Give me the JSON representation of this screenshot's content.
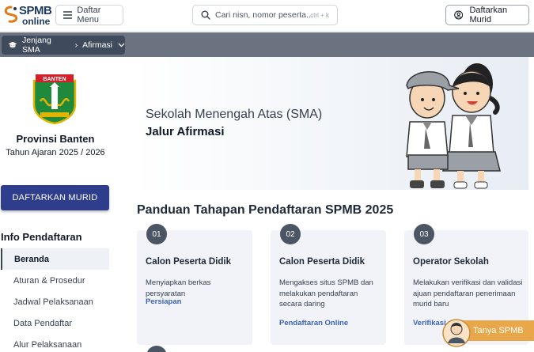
{
  "header": {
    "logo_line1": "SPMB",
    "logo_line2": "online",
    "menu_label": "Daftar Menu",
    "search_placeholder": "Cari nisn, nomor peserta...",
    "search_shortcut": "ctrl + k",
    "register_label": "Daftarkan Murid"
  },
  "breadcrumb": {
    "items": [
      "Jenjang SMA",
      "Afirmasi"
    ]
  },
  "sidebar": {
    "emblem_text": "BANTEN",
    "province": "Provinsi Banten",
    "academic_year": "Tahun Ajaran 2025 / 2026",
    "register_button": "DAFTARKAN MURID",
    "info_title": "Info Pendaftaran",
    "nav": [
      "Beranda",
      "Aturan & Prosedur",
      "Jadwal Pelaksanaan",
      "Data Pendaftar",
      "Alur Pelaksanaan"
    ],
    "active_index": 0
  },
  "hero": {
    "line1": "Sekolah Menengah Atas (SMA)",
    "line2": "Jalur Afirmasi"
  },
  "panduan": {
    "title": "Panduan Tahapan Pendaftaran SPMB 2025",
    "cards": [
      {
        "num": "01",
        "title": "Calon Peserta Didik",
        "desc": "Menyiapkan berkas persyaratan",
        "link": "Persiapan"
      },
      {
        "num": "02",
        "title": "Calon Peserta Didik",
        "desc": "Mengakses situs SPMB dan melakukan pendaftaran secara daring",
        "link": "Pendaftaran Online"
      },
      {
        "num": "03",
        "title": "Operator Sekolah",
        "desc": "Melakukan verifikasi dan validasi ajuan pendaftaran penerimaan murid baru",
        "link": "Verifikasi"
      }
    ]
  },
  "help": {
    "label": "Tanya SPMB"
  },
  "colors": {
    "primary_button": "#2f3e8c",
    "breadcrumb_band": "#6b7280",
    "link": "#3b63b8",
    "help_pill": "#e8a84a"
  }
}
